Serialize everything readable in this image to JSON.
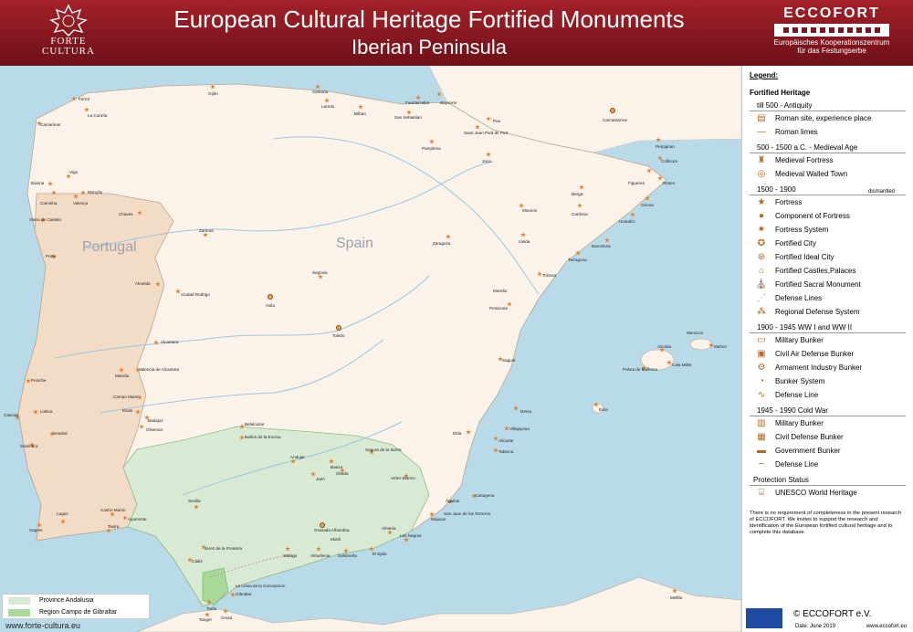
{
  "header": {
    "title": "European Cultural Heritage Fortified Monuments",
    "subtitle": "Iberian Peninsula",
    "logo_left_line1": "FORTE",
    "logo_left_line2": "CULTURA",
    "logo_right_name": "ECCOFORT",
    "logo_right_line1": "Europäisches Kooperationszentrum",
    "logo_right_line2": "für das Festungserbe",
    "colors": {
      "header": "#8b1a22",
      "land": "#fbf2ea",
      "sea": "#b9dbe9",
      "andalusia": "#d8ead3",
      "portugal": "#f3dcc6"
    }
  },
  "map": {
    "countries": [
      "Portugal",
      "Spain"
    ],
    "places": [
      {
        "name": "Ferrol"
      },
      {
        "name": "La Coruña"
      },
      {
        "name": "Camarinas"
      },
      {
        "name": "Gijón"
      },
      {
        "name": "Santona"
      },
      {
        "name": "Laredo"
      },
      {
        "name": "Bilbao"
      },
      {
        "name": "Fuenterrabia"
      },
      {
        "name": "Bayonne"
      },
      {
        "name": "San Sebastian"
      },
      {
        "name": "Pau"
      },
      {
        "name": "Saint Jean Pied de Port"
      },
      {
        "name": "Pamplona"
      },
      {
        "name": "Jaca"
      },
      {
        "name": "Carcassonne"
      },
      {
        "name": "Perpignan"
      },
      {
        "name": "Collioure"
      },
      {
        "name": "Figueres"
      },
      {
        "name": "Roses"
      },
      {
        "name": "Girona"
      },
      {
        "name": "Hostalric"
      },
      {
        "name": "Barcelona"
      },
      {
        "name": "Tarragona"
      },
      {
        "name": "Lleida"
      },
      {
        "name": "Monzon"
      },
      {
        "name": "Cardona"
      },
      {
        "name": "Berga"
      },
      {
        "name": "Zaragoza"
      },
      {
        "name": "Tortosa"
      },
      {
        "name": "Morella"
      },
      {
        "name": "Peniscola"
      },
      {
        "name": "Segovia"
      },
      {
        "name": "Avila"
      },
      {
        "name": "Toledo"
      },
      {
        "name": "Zamora"
      },
      {
        "name": "Chaves"
      },
      {
        "name": "Ciudad Rodrigo"
      },
      {
        "name": "Almeida"
      },
      {
        "name": "Alcantara"
      },
      {
        "name": "Valencia de Alcantara"
      },
      {
        "name": "Marvão"
      },
      {
        "name": "Campo Maior"
      },
      {
        "name": "Elvas"
      },
      {
        "name": "Badajoz"
      },
      {
        "name": "Olivenza"
      },
      {
        "name": "Lisboa"
      },
      {
        "name": "Peniche"
      },
      {
        "name": "Almeida"
      },
      {
        "name": "Cascais"
      },
      {
        "name": "Setubal"
      },
      {
        "name": "Sesimbra"
      },
      {
        "name": "Porto"
      },
      {
        "name": "Valença"
      },
      {
        "name": "Caminha"
      },
      {
        "name": "Vigo"
      },
      {
        "name": "Baiona"
      },
      {
        "name": "Monção"
      },
      {
        "name": "Viana do Castelo"
      },
      {
        "name": "Sagunt"
      },
      {
        "name": "Denia"
      },
      {
        "name": "Alicante"
      },
      {
        "name": "Villajoyosa"
      },
      {
        "name": "Tabarca"
      },
      {
        "name": "Elda"
      },
      {
        "name": "Cartagena"
      },
      {
        "name": "Águilas"
      },
      {
        "name": "Mojacar"
      },
      {
        "name": "San Juan de los Terreros"
      },
      {
        "name": "Almeria"
      },
      {
        "name": "Las Negras"
      },
      {
        "name": "Granada Alhambra"
      },
      {
        "name": "Malaga"
      },
      {
        "name": "Almuñecar"
      },
      {
        "name": "Salobreña"
      },
      {
        "name": "El Ejido"
      },
      {
        "name": "Motril"
      },
      {
        "name": "Sevilla"
      },
      {
        "name": "Cádiz"
      },
      {
        "name": "Tarifa"
      },
      {
        "name": "Gibraltar"
      },
      {
        "name": "La Linea de la Concepcion"
      },
      {
        "name": "Jerez de la Frontera"
      },
      {
        "name": "Ayamonte"
      },
      {
        "name": "Castro Marim"
      },
      {
        "name": "Tavira"
      },
      {
        "name": "Lagos"
      },
      {
        "name": "Sagres"
      },
      {
        "name": "Belalcazar"
      },
      {
        "name": "Baños de la Encina"
      },
      {
        "name": "Andujar"
      },
      {
        "name": "Jaén"
      },
      {
        "name": "Baeza"
      },
      {
        "name": "Úbeda"
      },
      {
        "name": "Segura de la Sierra"
      },
      {
        "name": "Vélez Blanco"
      },
      {
        "name": "Ibiza"
      },
      {
        "name": "Palma de Mallorca"
      },
      {
        "name": "Alcudia"
      },
      {
        "name": "Cala Millor"
      },
      {
        "name": "Mahon"
      },
      {
        "name": "Menorca"
      },
      {
        "name": "Ceuta"
      },
      {
        "name": "Tanger"
      },
      {
        "name": "Melilla"
      }
    ],
    "bottom_legend": [
      {
        "label": "Province Andalusia",
        "color": "#d8ead3"
      },
      {
        "label": "Region Campo de Gibraltar",
        "color": "#a6d99a"
      }
    ],
    "website": "www.forte-cultura.eu"
  },
  "legend": {
    "title": "Legend:",
    "section": "Fortified Heritage",
    "periods": [
      {
        "label": "till 500 - Antiquity",
        "items": [
          "Roman site, experience place",
          "Roman limes"
        ]
      },
      {
        "label": "500 - 1500 a.C. - Medieval Age",
        "items": [
          "Medieval Fortress",
          "Medieval Walled Town"
        ]
      },
      {
        "label": "1500 - 1900",
        "items": [
          "Fortress",
          "Component of Fortress",
          "Fortress System",
          "Fortified City",
          "Fortified Ideal City",
          "Fortified Castles,Palaces",
          "Fortified Sacral Monument",
          "Defense Lines",
          "Regional Defense System"
        ]
      },
      {
        "label": "1900 - 1945   WW I and WW II",
        "items": [
          "Military Bunker",
          "Civil Air Defense Bunker",
          "Armament Industry Bunker",
          "Bunker System",
          "Defense Line"
        ]
      },
      {
        "label": "1945 - 1990   Cold War",
        "items": [
          "Military Bunker",
          "Civil Defense Bunker",
          "Government Bunker",
          "Defense Line"
        ]
      }
    ],
    "dismantled": "dismantled",
    "protection_title": "Protection Status",
    "protection_item": "UNESCO World Heritage",
    "note": "There is no requirement of completeness in the present research of ECCOFORT. We invites to support the research and identification of the European fortified cultural heritage and to complete this database.",
    "copyright": "© ECCOFORT e.V.",
    "date": "Date: June 2019",
    "website": "www.eccofort.eu"
  }
}
